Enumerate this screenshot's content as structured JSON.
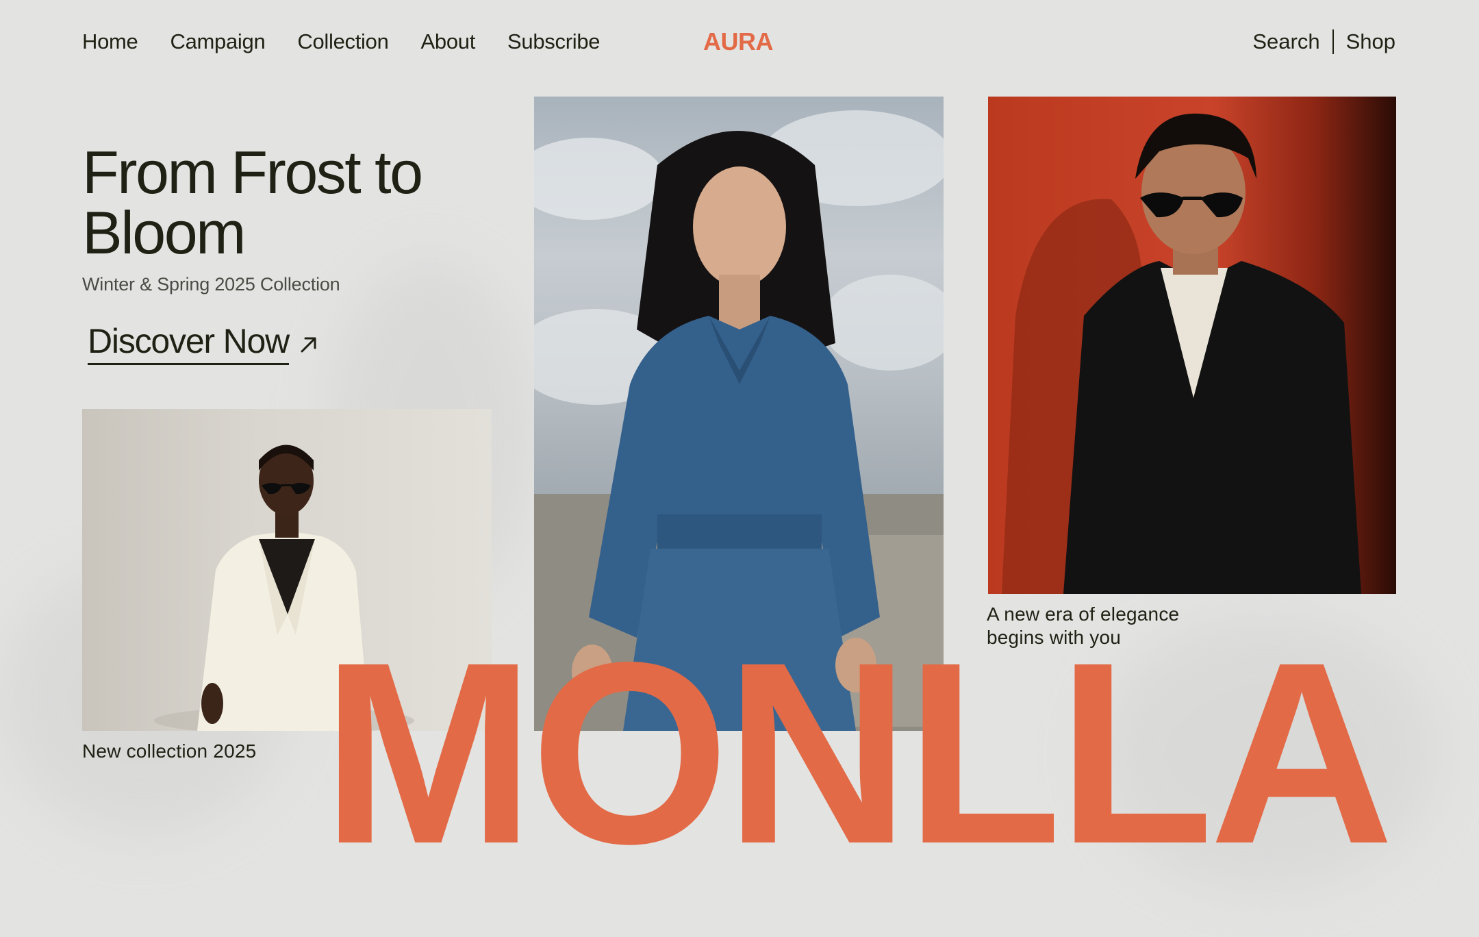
{
  "nav": {
    "links": [
      "Home",
      "Campaign",
      "Collection",
      "About",
      "Subscribe"
    ],
    "logo": "AURA",
    "right_links": [
      "Search",
      "Shop"
    ]
  },
  "hero": {
    "title": "From Frost to Bloom",
    "subtitle": "Winter & Spring 2025 Collection",
    "cta_label": "Discover Now",
    "cta_icon": "arrow-up-right-icon"
  },
  "captions": {
    "left": "New collection 2025",
    "right": "A new era of elegance begins with you"
  },
  "brand_word": "MONLLA",
  "colors": {
    "accent": "#e36a46",
    "text": "#1e2113",
    "background": "#e3e3e2"
  }
}
